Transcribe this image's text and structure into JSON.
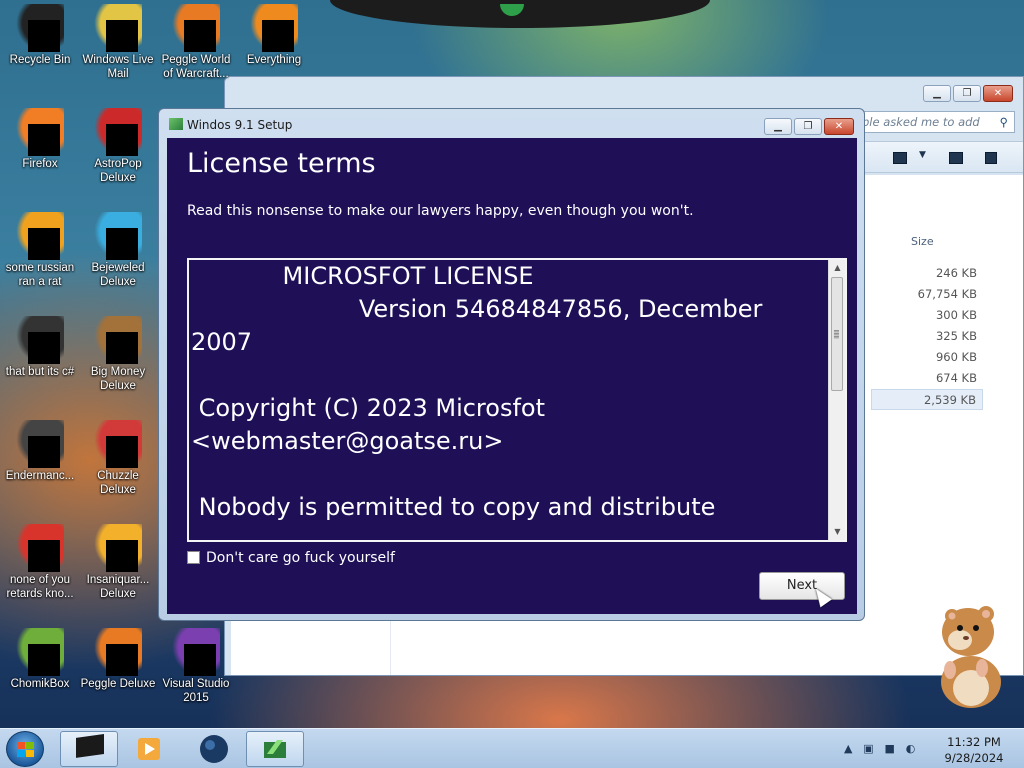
{
  "desktop": {
    "icons": [
      {
        "label": "Recycle Bin",
        "icon": "recycle-bin-icon"
      },
      {
        "label": "Windows Live Mail",
        "icon": "mail-icon"
      },
      {
        "label": "Peggle World of Warcraft...",
        "icon": "peggle-wow-icon"
      },
      {
        "label": "Everything",
        "icon": "everything-search-icon"
      },
      {
        "label": "Firefox",
        "icon": "firefox-icon"
      },
      {
        "label": "AstroPop Deluxe",
        "icon": "astropop-icon"
      },
      {
        "label": "some russian ran a rat",
        "icon": "e-app-icon"
      },
      {
        "label": "Bejeweled Deluxe",
        "icon": "bejeweled-icon"
      },
      {
        "label": "that but its c#",
        "icon": "stacked-windows-icon"
      },
      {
        "label": "Big Money Deluxe",
        "icon": "money-bag-icon"
      },
      {
        "label": "Endermanc...",
        "icon": "terminal-icon"
      },
      {
        "label": "Chuzzle Deluxe",
        "icon": "chuzzle-icon"
      },
      {
        "label": "none of you retards kno...",
        "icon": "opera-like-icon"
      },
      {
        "label": "Insaniquar... Deluxe",
        "icon": "fish-icon"
      },
      {
        "label": "ChomikBox",
        "icon": "chomikbox-icon"
      },
      {
        "label": "Peggle Deluxe",
        "icon": "peggle-icon"
      },
      {
        "label": "Visual Studio 2015",
        "icon": "visual-studio-icon"
      }
    ]
  },
  "explorer": {
    "search_placeholder": "ple asked me to add",
    "column_size": "Size",
    "sizes": [
      "246 KB",
      "67,754 KB",
      "300 KB",
      "325 KB",
      "960 KB",
      "674 KB",
      "2,539 KB"
    ]
  },
  "dialog": {
    "title": "Windos 9.1 Setup",
    "heading": "License terms",
    "subtitle": "Read this nonsense to make our lawyers happy, even though you won't.",
    "license_lines": [
      "            MICROSFOT LICENSE",
      "                      Version 54684847856, December",
      "2007",
      "",
      " Copyright (C) 2023 Microsfot",
      "<webmaster@goatse.ru>",
      "",
      " Nobody is permitted to copy and distribute"
    ],
    "checkbox_label": "Don't care go fuck yourself",
    "checkbox_checked": false,
    "next_label": "Next"
  },
  "taskbar": {
    "time": "11:32 PM",
    "date": "9/28/2024"
  },
  "colors": {
    "dialog_bg": "#1e0f57",
    "taskbar": "#b7cfe9"
  }
}
